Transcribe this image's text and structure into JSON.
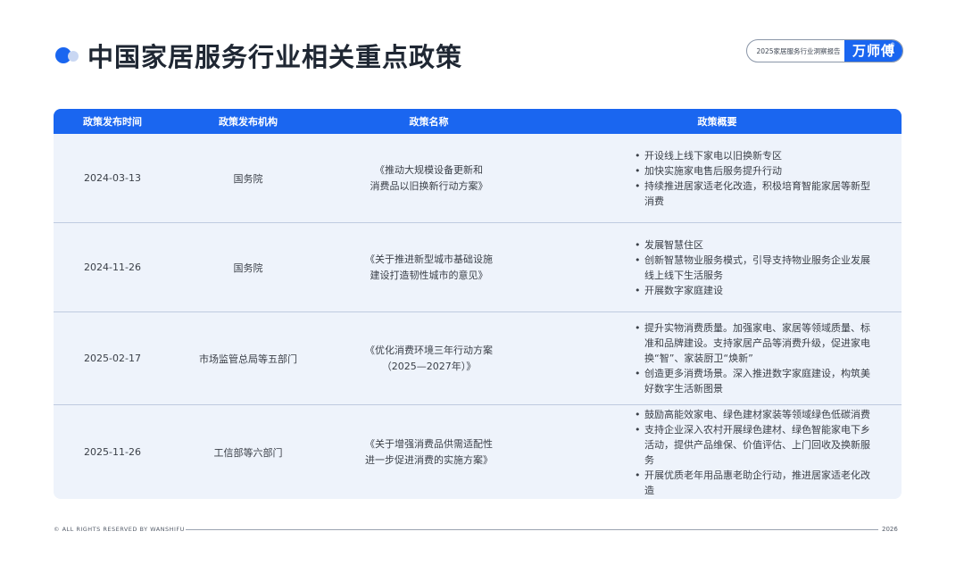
{
  "header": {
    "title": "中国家居服务行业相关重点政策",
    "report_label": "2025家居服务行业洞察报告",
    "brand": "万师傅",
    "brand_mark": "®"
  },
  "table": {
    "columns": [
      "政策发布时间",
      "政策发布机构",
      "政策名称",
      "政策概要"
    ],
    "rows": [
      {
        "date": "2024-03-13",
        "org": "国务院",
        "name_lines": [
          "《推动大规模设备更新和",
          "消费品以旧换新行动方案》"
        ],
        "summary": [
          "开设线上线下家电以旧换新专区",
          "加快实施家电售后服务提升行动",
          "持续推进居家适老化改造，积极培育智能家居等新型消费"
        ]
      },
      {
        "date": "2024-11-26",
        "org": "国务院",
        "name_lines": [
          "《关于推进新型城市基础设施",
          "建设打造韧性城市的意见》"
        ],
        "summary": [
          "发展智慧住区",
          "创新智慧物业服务模式，引导支持物业服务企业发展线上线下生活服务",
          "开展数字家庭建设"
        ]
      },
      {
        "date": "2025-02-17",
        "org": "市场监管总局等五部门",
        "name_lines": [
          "《优化消费环境三年行动方案",
          "（2025—2027年）》"
        ],
        "summary": [
          "提升实物消费质量。加强家电、家居等领域质量、标准和品牌建设。支持家居产品等消费升级，促进家电换“智”、家装厨卫“焕新”",
          "创造更多消费场景。深入推进数字家庭建设，构筑美好数字生活新图景"
        ]
      },
      {
        "date": "2025-11-26",
        "org": "工信部等六部门",
        "name_lines": [
          "《关于增强消费品供需适配性",
          "进一步促进消费的实施方案》"
        ],
        "summary": [
          "鼓励高能效家电、绿色建材家装等领域绿色低碳消费",
          "支持企业深入农村开展绿色建材、绿色智能家电下乡活动，提供产品维保、价值评估、上门回收及换新服务",
          "开展优质老年用品惠老助企行动，推进居家适老化改造"
        ]
      }
    ]
  },
  "footer": {
    "copyright": "© ALL RIGHTS RESERVED BY WANSHIFU",
    "year": "2026"
  }
}
